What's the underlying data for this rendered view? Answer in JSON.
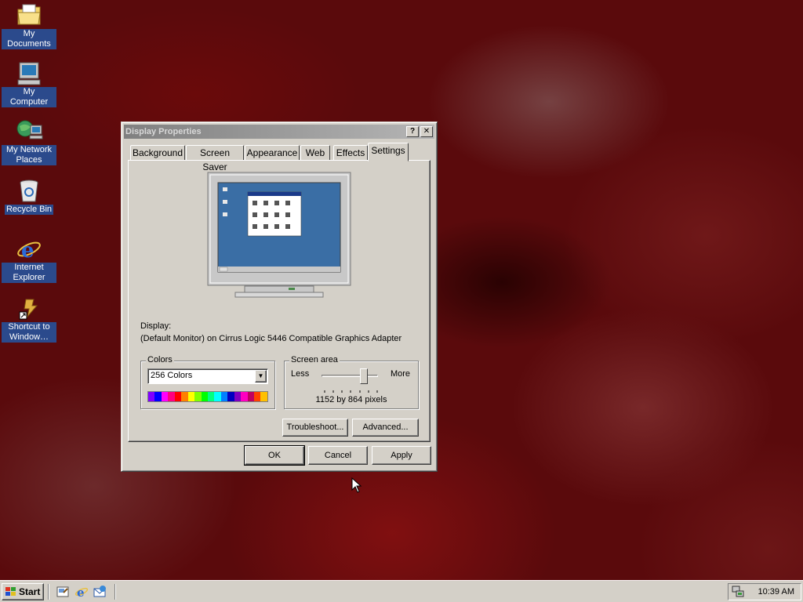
{
  "desktop": {
    "icons": [
      {
        "label": "My Documents",
        "icon": "folder-documents-icon"
      },
      {
        "label": "My Computer",
        "icon": "computer-icon"
      },
      {
        "label": "My Network Places",
        "icon": "network-icon"
      },
      {
        "label": "Recycle Bin",
        "icon": "recycle-bin-icon"
      },
      {
        "label": "Internet Explorer",
        "icon": "internet-explorer-icon"
      },
      {
        "label": "Shortcut to Window…",
        "icon": "shortcut-icon"
      }
    ]
  },
  "window": {
    "title": "Display Properties",
    "help_label": "?",
    "close_label": "✕",
    "tabs": [
      "Background",
      "Screen Saver",
      "Appearance",
      "Web",
      "Effects",
      "Settings"
    ],
    "active_tab": "Settings",
    "display_label": "Display:",
    "display_value": "(Default Monitor) on Cirrus Logic 5446 Compatible Graphics Adapter",
    "colors": {
      "group_title": "Colors",
      "selected": "256 Colors",
      "swatches": [
        "#8000ff",
        "#0000ff",
        "#ff00ff",
        "#ff0080",
        "#ff0000",
        "#ff8000",
        "#ffff00",
        "#80ff00",
        "#00ff00",
        "#00ff80",
        "#00ffff",
        "#0080ff",
        "#0000c0",
        "#8000c0",
        "#ff00c0",
        "#c00060",
        "#ff4000",
        "#ffc000"
      ]
    },
    "screen_area": {
      "group_title": "Screen area",
      "less_label": "Less",
      "more_label": "More",
      "resolution_text": "1152 by 864 pixels",
      "slider_level": 0.75
    },
    "buttons": {
      "troubleshoot": "Troubleshoot...",
      "advanced": "Advanced...",
      "ok": "OK",
      "cancel": "Cancel",
      "apply": "Apply"
    }
  },
  "taskbar": {
    "start_label": "Start",
    "quick_launch": [
      "show-desktop-icon",
      "internet-explorer-icon",
      "outlook-express-icon"
    ],
    "clock": "10:39 AM"
  }
}
